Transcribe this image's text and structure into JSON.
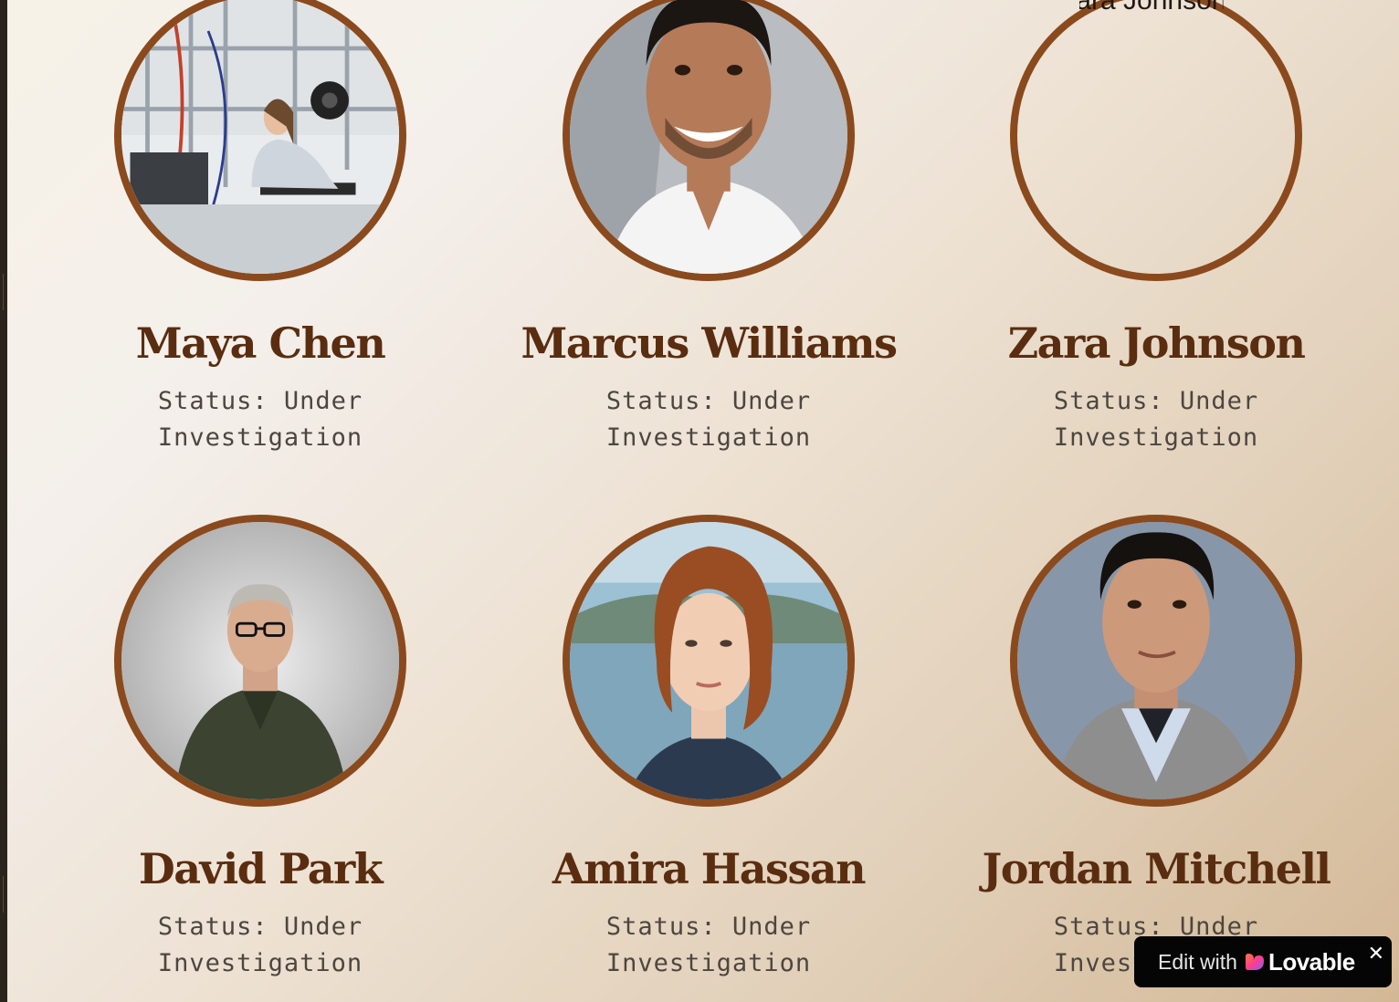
{
  "suspects": [
    {
      "name": "Maya Chen",
      "status_line1": "Status: Under",
      "status_line2": "Investigation",
      "photo": "woman-working-in-lab"
    },
    {
      "name": "Marcus Williams",
      "status_line1": "Status: Under",
      "status_line2": "Investigation",
      "photo": "smiling-man-portrait"
    },
    {
      "name": "Zara Johnson",
      "status_line1": "Status: Under",
      "status_line2": "Investigation",
      "photo_alt": "Zara Johnson"
    },
    {
      "name": "David Park",
      "status_line1": "Status: Under",
      "status_line2": "Investigation",
      "photo": "man-with-glasses-portrait"
    },
    {
      "name": "Amira Hassan",
      "status_line1": "Status: Under",
      "status_line2": "Investigation",
      "photo": "red-haired-woman-portrait"
    },
    {
      "name": "Jordan Mitchell",
      "status_line1": "Status: Under",
      "status_line2": "Investigation",
      "photo": "man-in-sweater-portrait"
    }
  ],
  "badge": {
    "edit_label": "Edit with",
    "brand_label": "Lovable",
    "close_glyph": "✕"
  },
  "colors": {
    "accent": "#8a4a1e",
    "name_text": "#5a2d10",
    "status_text": "#4d4640"
  }
}
